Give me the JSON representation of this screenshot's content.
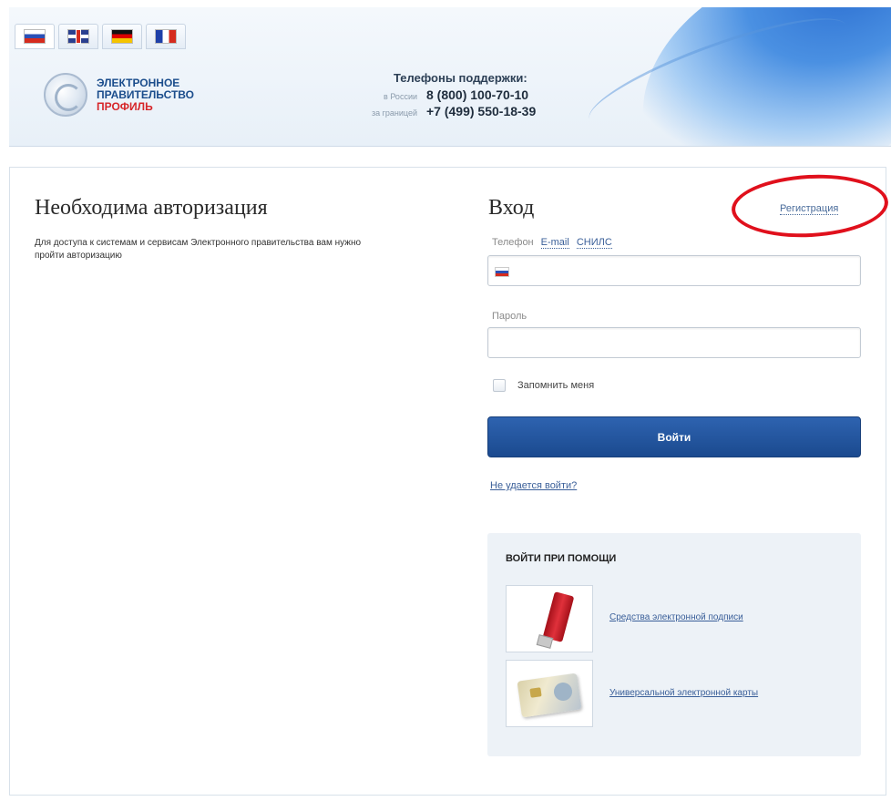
{
  "header": {
    "languages": [
      {
        "name": "ru",
        "active": true
      },
      {
        "name": "en",
        "active": false
      },
      {
        "name": "de",
        "active": false
      },
      {
        "name": "fr",
        "active": false
      }
    ],
    "logo": {
      "line1": "ЭЛЕКТРОННОЕ",
      "line2": "ПРАВИТЕЛЬСТВО",
      "line3": "ПРОФИЛЬ"
    },
    "support": {
      "title": "Телефоны поддержки:",
      "russia_label": "в России",
      "russia_number": "8 (800) 100-70-10",
      "abroad_label": "за границей",
      "abroad_number": "+7 (499) 550-18-39"
    }
  },
  "left": {
    "title": "Необходима авторизация",
    "description": "Для доступа к системам и сервисам Электронного правительства вам нужно пройти авторизацию"
  },
  "login": {
    "title": "Вход",
    "register_link": "Регистрация",
    "tabs": [
      "Телефон",
      "E-mail",
      "СНИЛС"
    ],
    "phone_value": "",
    "password_label": "Пароль",
    "password_value": "",
    "remember_label": "Запомнить меня",
    "submit_label": "Войти",
    "forgot_link": "Не удается войти?"
  },
  "alt_login": {
    "title": "ВОЙТИ ПРИ ПОМОЩИ",
    "options": [
      {
        "label": "Средства электронной подписи",
        "icon": "usb-token-icon"
      },
      {
        "label": "Универсальной электронной карты",
        "icon": "smart-card-icon"
      }
    ]
  },
  "colors": {
    "primary_button": "#1f4f96",
    "link": "#3a5f99",
    "logo_blue": "#1b4d8c",
    "logo_red": "#d6262a",
    "annotation_red": "#e0101c"
  }
}
